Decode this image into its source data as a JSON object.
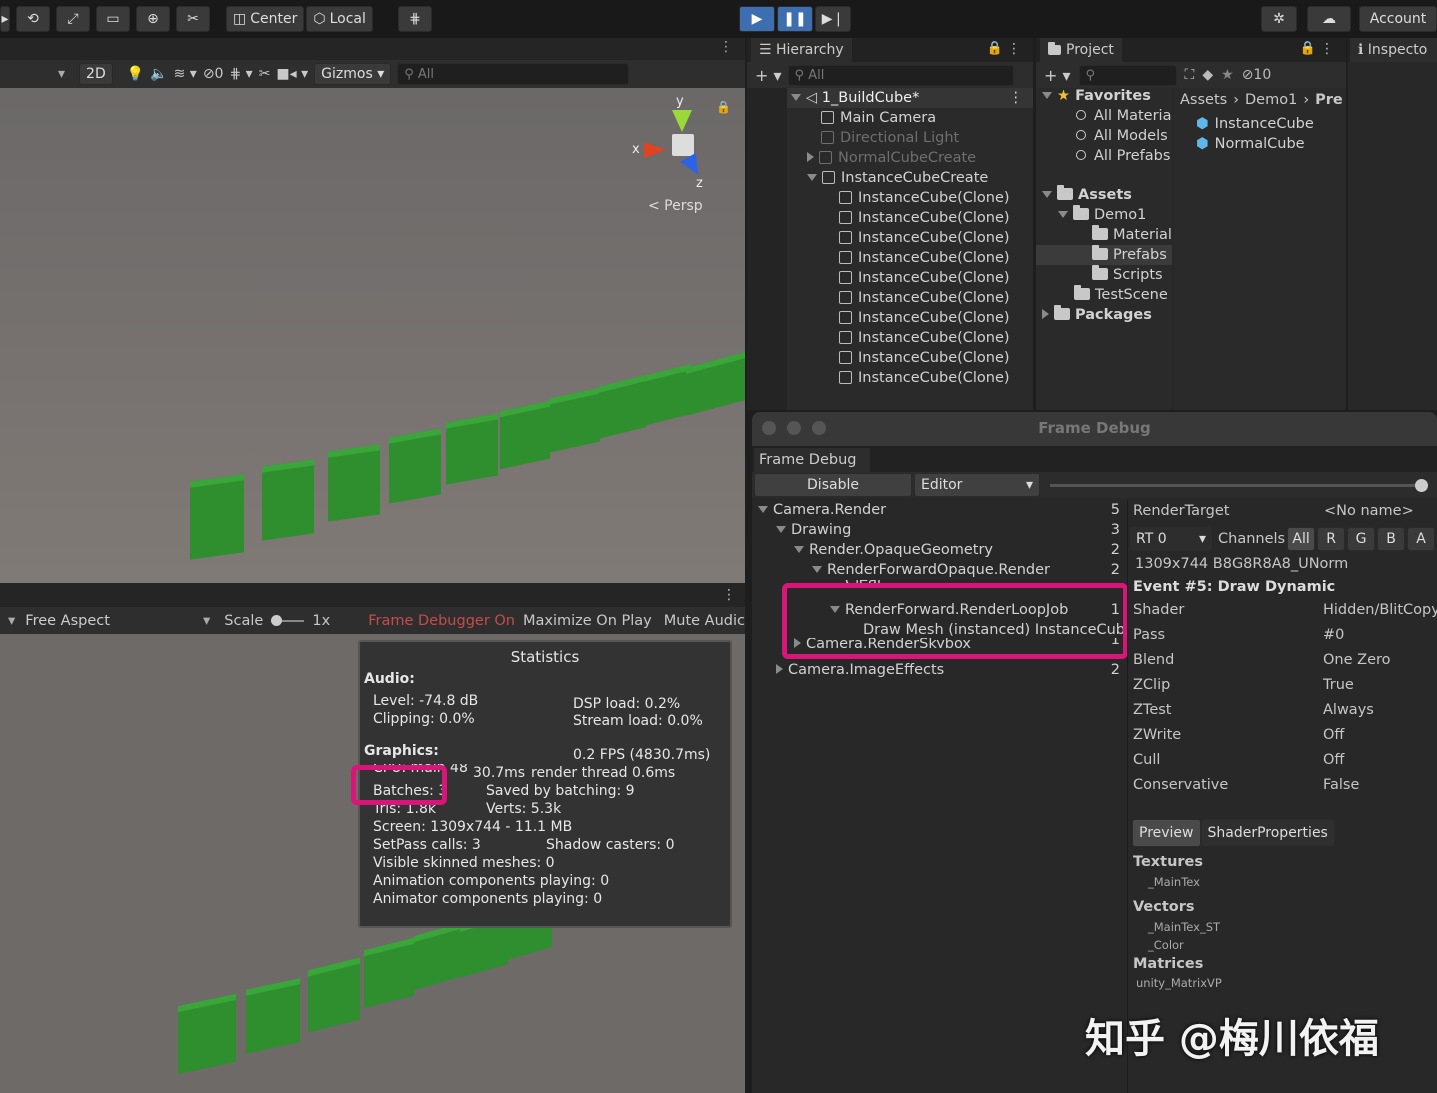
{
  "toolbar": {
    "pivot": "Center",
    "space": "Local",
    "account": "Account"
  },
  "scene": {
    "mode2d": "2D",
    "hidden_count": "0",
    "gizmos": "Gizmos",
    "search_placeholder": "All",
    "axis_y": "y",
    "axis_x": "x",
    "axis_z": "z",
    "persp": "< Persp"
  },
  "hierarchy": {
    "tab": "Hierarchy",
    "search_placeholder": "All",
    "scene_name": "1_BuildCube*",
    "items": [
      {
        "label": "Main Camera",
        "dim": false
      },
      {
        "label": "Directional Light",
        "dim": true
      },
      {
        "label": "NormalCubeCreate",
        "dim": true
      },
      {
        "label": "InstanceCubeCreate",
        "dim": false
      }
    ],
    "clones": [
      "InstanceCube(Clone)",
      "InstanceCube(Clone)",
      "InstanceCube(Clone)",
      "InstanceCube(Clone)",
      "InstanceCube(Clone)",
      "InstanceCube(Clone)",
      "InstanceCube(Clone)",
      "InstanceCube(Clone)",
      "InstanceCube(Clone)",
      "InstanceCube(Clone)"
    ]
  },
  "project": {
    "tab": "Project",
    "hidden_count": "10",
    "favorites": "Favorites",
    "fav_items": [
      "All Materia",
      "All Models",
      "All Prefabs"
    ],
    "assets": "Assets",
    "demo1": "Demo1",
    "folders": [
      "Material",
      "Prefabs",
      "Scripts"
    ],
    "testscene": "TestScene",
    "packages": "Packages",
    "breadcrumb": [
      "Assets",
      "Demo1",
      "Pre"
    ],
    "files": [
      "InstanceCube",
      "NormalCube"
    ]
  },
  "inspector": {
    "tab": "Inspecto"
  },
  "game": {
    "aspect": "Free Aspect",
    "scale_label": "Scale",
    "scale_value": "1x",
    "frame_debugger": "Frame Debugger On",
    "maximize": "Maximize On Play",
    "mute": "Mute Audic"
  },
  "statistics": {
    "title": "Statistics",
    "audio_header": "Audio:",
    "level": "Level: -74.8 dB",
    "clipping": "Clipping: 0.0%",
    "dsp": "DSP load: 0.2%",
    "stream": "Stream load: 0.0%",
    "graphics_header": "Graphics:",
    "fps": "0.2 FPS (4830.7ms)",
    "cpu": "CPU: main 48",
    "cpu_ms": "30.7ms",
    "render_thread": "render thread 0.6ms",
    "batches": "Batches: 3",
    "saved": "Saved by batching: 9",
    "tris": "Tris: 1.8k",
    "verts": "Verts: 5.3k",
    "screen": "Screen: 1309x744 - 11.1 MB",
    "setpass": "SetPass calls: 3",
    "shadow": "Shadow casters: 0",
    "skinned": "Visible skinned meshes: 0",
    "anim": "Animation components playing: 0",
    "animator": "Animator components playing: 0"
  },
  "frame_debug": {
    "window_title": "Frame Debug",
    "tab": "Frame Debug",
    "disable": "Disable",
    "target": "Editor",
    "tree": [
      {
        "label": "Camera.Render",
        "count": "5",
        "depth": 0,
        "arrow": "down"
      },
      {
        "label": "Drawing",
        "count": "3",
        "depth": 1,
        "arrow": "down"
      },
      {
        "label": "Render.OpaqueGeometry",
        "count": "2",
        "depth": 2,
        "arrow": "down"
      },
      {
        "label": "RenderForwardOpaque.Render",
        "count": "2",
        "depth": 3,
        "arrow": "down"
      },
      {
        "label": "Clear",
        "count": "",
        "depth": 4,
        "arrow": "none"
      },
      {
        "label": "RenderForward.RenderLoopJob",
        "count": "1",
        "depth": 4,
        "arrow": "down"
      },
      {
        "label": "Draw Mesh (instanced) InstanceCube",
        "count": "",
        "depth": 5,
        "arrow": "none"
      },
      {
        "label": "Camera.RenderSkybox",
        "count": "1",
        "depth": 2,
        "arrow": "right"
      },
      {
        "label": "Camera.ImageEffects",
        "count": "2",
        "depth": 1,
        "arrow": "right"
      }
    ],
    "render_target_label": "RenderTarget",
    "render_target_value": "<No name>",
    "rt": "RT 0",
    "channels": "Channels",
    "channel_buttons": [
      "All",
      "R",
      "G",
      "B",
      "A"
    ],
    "format": "1309x744 B8G8R8A8_UNorm",
    "event": "Event #5: Draw Dynamic",
    "props": [
      {
        "k": "Shader",
        "v": "Hidden/BlitCopy"
      },
      {
        "k": "Pass",
        "v": "#0"
      },
      {
        "k": "Blend",
        "v": "One Zero"
      },
      {
        "k": "ZClip",
        "v": "True"
      },
      {
        "k": "ZTest",
        "v": "Always"
      },
      {
        "k": "ZWrite",
        "v": "Off"
      },
      {
        "k": "Cull",
        "v": "Off"
      },
      {
        "k": "Conservative",
        "v": "False"
      }
    ],
    "preview_tab": "Preview",
    "shader_props_tab": "ShaderProperties",
    "textures": "Textures",
    "tex1": "_MainTex",
    "vectors": "Vectors",
    "vec1": "_MainTex_ST",
    "vec2": "_Color",
    "matrices": "Matrices",
    "mat1": "unity_MatrixVP"
  },
  "watermark": "知乎 @梅川依福",
  "colors": {
    "accent_play": "#3d6fb0",
    "highlight": "#d9157a",
    "cube_green": "#2f8f2f"
  }
}
